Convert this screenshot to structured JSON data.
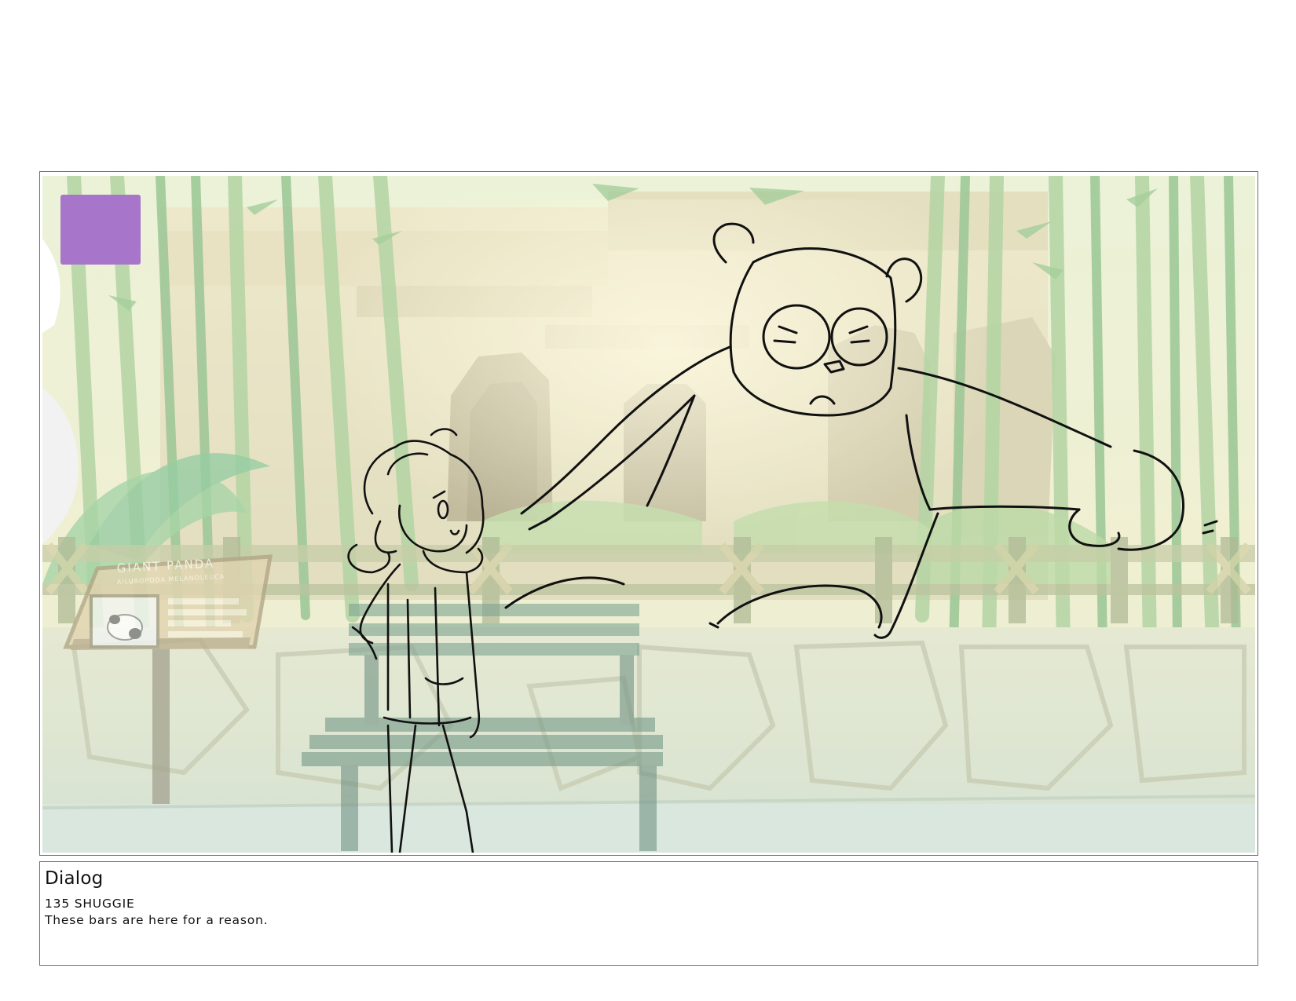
{
  "panel": {
    "scene": "storyboard-panel",
    "marker_color": "#a775c9"
  },
  "sign": {
    "title": "GIANT PANDA",
    "subtitle": "AILUROPODA MELANOLEUCA"
  },
  "dialog": {
    "heading": "Dialog",
    "speaker": "135 SHUGGIE",
    "line": "These bars are here for a reason."
  }
}
